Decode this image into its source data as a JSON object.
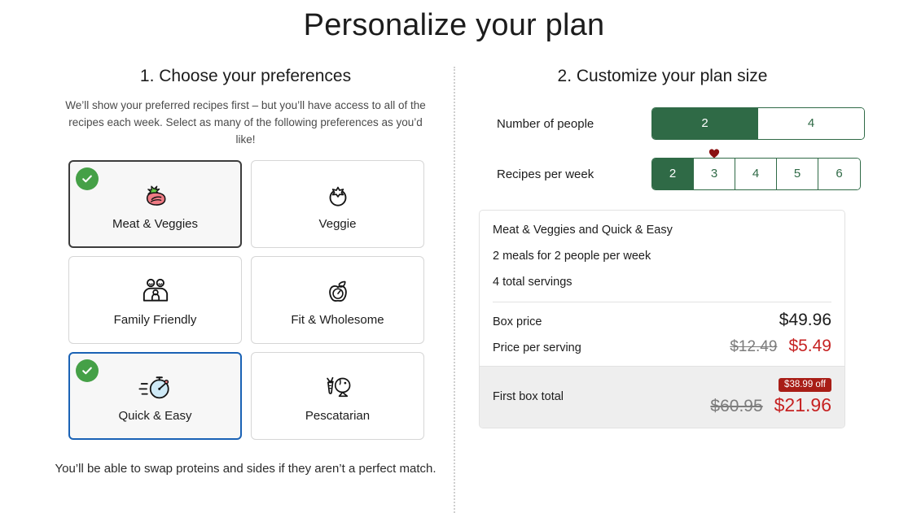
{
  "page": {
    "title": "Personalize your plan"
  },
  "left": {
    "heading": "1. Choose your preferences",
    "subtext": "We’ll show your preferred recipes first – but you’ll have access to all of the recipes each week. Select as many of the following preferences as you’d like!",
    "footnote": "You’ll be able to swap proteins and sides if they aren’t a perfect match.",
    "cards": [
      {
        "label": "Meat & Veggies",
        "icon": "steak-icon",
        "selected": true,
        "state": "selected-dark"
      },
      {
        "label": "Veggie",
        "icon": "tomato-icon",
        "selected": false,
        "state": ""
      },
      {
        "label": "Family Friendly",
        "icon": "family-icon",
        "selected": false,
        "state": ""
      },
      {
        "label": "Fit & Wholesome",
        "icon": "apple-meter-icon",
        "selected": false,
        "state": ""
      },
      {
        "label": "Quick & Easy",
        "icon": "stopwatch-icon",
        "selected": true,
        "state": "selected-focus"
      },
      {
        "label": "Pescatarian",
        "icon": "carrot-fish-icon",
        "selected": false,
        "state": ""
      }
    ]
  },
  "right": {
    "heading": "2. Customize your plan size",
    "people": {
      "label": "Number of people",
      "options": [
        "2",
        "4"
      ],
      "selected": "2"
    },
    "recipes": {
      "label": "Recipes per week",
      "options": [
        "2",
        "3",
        "4",
        "5",
        "6"
      ],
      "selected": "2",
      "favorite_marker_option": "3",
      "favorite_icon": "heart-icon"
    },
    "summary": {
      "preferences_line": "Meat & Veggies and Quick & Easy",
      "meals_line": "2 meals for 2 people per week",
      "servings_line": "4 total servings",
      "rows": [
        {
          "label": "Box price",
          "old": "",
          "new": "$49.96",
          "new_color": "black"
        },
        {
          "label": "Price per serving",
          "old": "$12.49",
          "new": "$5.49",
          "new_color": "red"
        }
      ],
      "total": {
        "label": "First box total",
        "badge": "$38.99 off",
        "old": "$60.95",
        "new": "$21.96"
      }
    }
  },
  "colors": {
    "green": "#2f6a46",
    "check_green": "#45a047",
    "red": "#c62222",
    "badge_red": "#a81d16",
    "focus_blue": "#1a62b5"
  }
}
